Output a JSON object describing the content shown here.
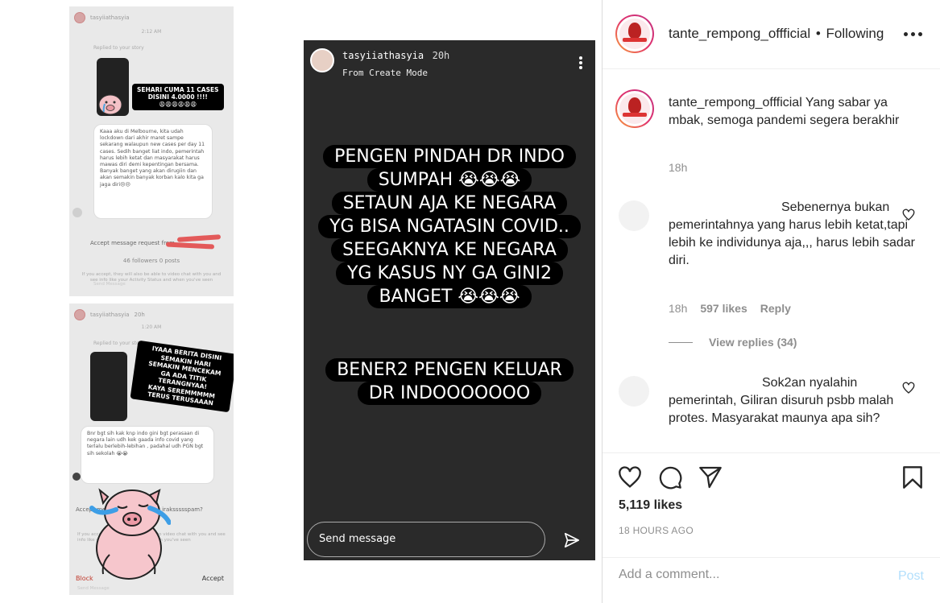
{
  "screenshot1": {
    "username": "tasyiiathasyia",
    "timestamp": "2:12 AM",
    "replied_label": "Replied to your story",
    "sticker_lines": [
      "SEHARI CUMA 11 CASES",
      "DISINI 4.0000 !!!!",
      "😩😩😩😩😩😩"
    ],
    "message": "Kaaa aku di Melbourne, kita udah lockdown dari akhir maret sampe sekarang walaupun new cases per day 11 cases. Sedih banget liat indo, pemerintah harus lebih ketat dan masyarakat harus mawas diri demi kepentingan bersama. Banyak banget yang akan dirugiin dan akan semakin banyak korban kalo kita ga jaga diri😔😔",
    "accept_label": "Accept message request from",
    "followers": "46 followers 0 posts",
    "fine_print": "If you accept, they will also be able to video chat with you and see info like your Activity Status and when you've seen",
    "send_message": "Send Message"
  },
  "screenshot2": {
    "username": "tasyiiathasyia",
    "age": "20h",
    "timestamp": "1:20 AM",
    "replied_label": "Replied to your story",
    "sticker_lines": [
      "IYAAA BERITA DISINI",
      "SEMAKIN HARI",
      "SEMAKIN MENCEKAM",
      "GA ADA TITIK TERANGNYAA!",
      "KAYA SEREMMMMM",
      "TERUS TERUSAAAN"
    ],
    "message": "Bnr bgt sih kak knp indo gini bgt perasaan di negara lain udh kek gaada info covid yang terlalu berlebih-lebihan , padahal udh PGN bgt sih sekolah 😭😭",
    "accept_label": "Accept message request from irakssssspam?",
    "fine_print": "If you accept, they will also be able to video chat with you and see info like your Activity Status and when you've seen",
    "block": "Block",
    "accept": "Accept",
    "send_message": "Send Message"
  },
  "story": {
    "username": "tasyiiathasyia",
    "age": "20h",
    "mode": "From Create Mode",
    "block1": [
      "PENGEN PINDAH DR INDO",
      "SUMPAH 😭😭😭",
      "SETAUN AJA KE NEGARA",
      "YG BISA NGATASIN COVID..",
      "SEEGAKNYA KE NEGARA",
      "YG KASUS NY GA GINI2",
      "BANGET 😭😭😭"
    ],
    "block2": [
      "BENER2 PENGEN KELUAR",
      "DR INDOOOOOOO"
    ],
    "send_placeholder": "Send message"
  },
  "header": {
    "username": "tante_rempong_offficial",
    "separator": "•",
    "follow_status": "Following"
  },
  "caption": {
    "username": "tante_rempong_offficial",
    "text": "Yang sabar ya mbak, semoga pandemi segera berakhir",
    "time": "18h"
  },
  "comments": [
    {
      "text": "Sebenernya bukan pemerintahnya yang harus lebih ketat,tapi lebih ke individunya aja,,, harus lebih sadar diri.",
      "time": "18h",
      "likes": "597 likes",
      "reply": "Reply",
      "view_replies": "View replies (34)"
    },
    {
      "text": "Sok2an nyalahin pemerintah, Giliran disuruh psbb malah protes. Masyarakat maunya apa sih?"
    }
  ],
  "actions": {
    "likes": "5,119 likes",
    "posted": "18 HOURS AGO"
  },
  "add_comment": {
    "placeholder": "Add a comment...",
    "post": "Post"
  },
  "colors": {
    "story_bg": "#2a2a2a",
    "post_button": "#b2dffc",
    "secondary_text": "#8e8e8e",
    "scribble_red": "#e35a5a"
  }
}
